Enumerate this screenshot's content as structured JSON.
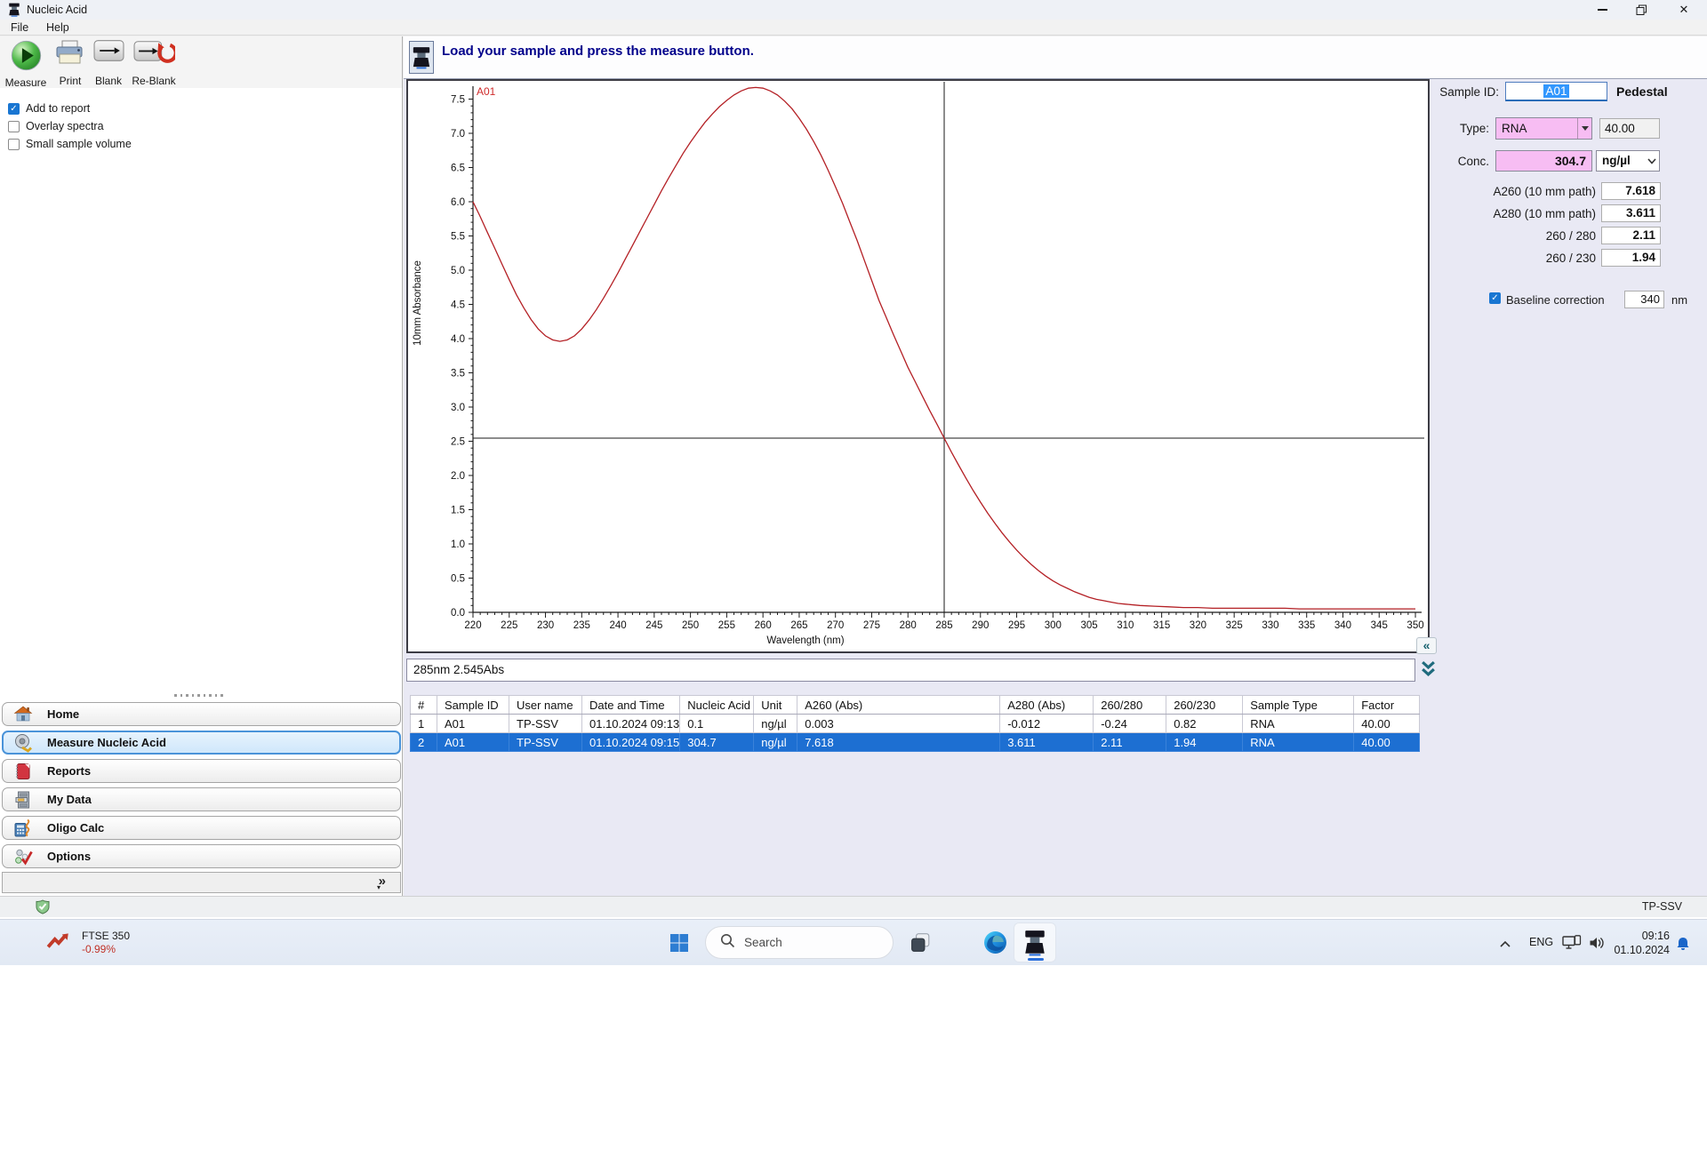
{
  "window": {
    "title": "Nucleic Acid"
  },
  "menu": {
    "items": [
      {
        "label": "File"
      },
      {
        "label": "Help"
      }
    ]
  },
  "toolbar": {
    "buttons": [
      {
        "id": "measure",
        "label": "Measure"
      },
      {
        "id": "print",
        "label": "Print"
      },
      {
        "id": "blank",
        "label": "Blank"
      },
      {
        "id": "reblank",
        "label": "Re-Blank"
      }
    ]
  },
  "options": {
    "items": [
      {
        "label": "Add to report",
        "checked": true
      },
      {
        "label": "Overlay spectra",
        "checked": false
      },
      {
        "label": "Small sample volume",
        "checked": false
      }
    ]
  },
  "message_bar": {
    "text": "Load your sample and press the measure button."
  },
  "chart_data": {
    "type": "line",
    "title": "",
    "xlabel": "Wavelength (nm)",
    "ylabel": "10mm Absorbance",
    "xlim": [
      220,
      350
    ],
    "ylim": [
      0,
      7.8
    ],
    "grid": false,
    "legend": "none",
    "x_ticks": [
      220,
      225,
      230,
      235,
      240,
      245,
      250,
      255,
      260,
      265,
      270,
      275,
      280,
      285,
      290,
      295,
      300,
      305,
      310,
      315,
      320,
      325,
      330,
      335,
      340,
      345,
      350
    ],
    "y_ticks": [
      0,
      0.5,
      1,
      1.5,
      2,
      2.5,
      3,
      3.5,
      4,
      4.5,
      5,
      5.5,
      6,
      6.5,
      7,
      7.5
    ],
    "x_minor_step": 1,
    "y_minor_step": 0.1,
    "series_label": {
      "text": "A01",
      "color": "#cf2a2a"
    },
    "crosshair": {
      "x": 285,
      "y": 2.545,
      "color": "#1a1a1a"
    },
    "series": [
      {
        "name": "A01",
        "color": "#b42025",
        "x": [
          220,
          221,
          222,
          223,
          224,
          225,
          226,
          227,
          228,
          229,
          230,
          231,
          232,
          233,
          234,
          235,
          236,
          237,
          238,
          239,
          240,
          241,
          242,
          243,
          244,
          245,
          246,
          247,
          248,
          249,
          250,
          251,
          252,
          253,
          254,
          255,
          256,
          257,
          258,
          259,
          260,
          261,
          262,
          263,
          264,
          265,
          266,
          267,
          268,
          269,
          270,
          271,
          272,
          273,
          274,
          275,
          276,
          277,
          278,
          279,
          280,
          281,
          282,
          283,
          284,
          285,
          286,
          287,
          288,
          289,
          290,
          291,
          292,
          293,
          294,
          295,
          296,
          297,
          298,
          299,
          300,
          301,
          302,
          303,
          304,
          305,
          306,
          307,
          308,
          309,
          310,
          312,
          314,
          316,
          318,
          320,
          322,
          324,
          326,
          328,
          330,
          332,
          334,
          336,
          338,
          340,
          342,
          344,
          346,
          348,
          350
        ],
        "y": [
          6.0,
          5.78,
          5.55,
          5.32,
          5.09,
          4.86,
          4.64,
          4.45,
          4.28,
          4.14,
          4.04,
          3.98,
          3.96,
          3.98,
          4.04,
          4.14,
          4.27,
          4.42,
          4.59,
          4.77,
          4.96,
          5.16,
          5.36,
          5.56,
          5.76,
          5.96,
          6.16,
          6.35,
          6.53,
          6.71,
          6.87,
          7.02,
          7.16,
          7.28,
          7.39,
          7.48,
          7.56,
          7.62,
          7.66,
          7.67,
          7.66,
          7.62,
          7.56,
          7.47,
          7.36,
          7.22,
          7.06,
          6.88,
          6.68,
          6.46,
          6.22,
          5.97,
          5.7,
          5.43,
          5.14,
          4.85,
          4.56,
          4.31,
          4.06,
          3.82,
          3.58,
          3.37,
          3.16,
          2.95,
          2.75,
          2.545,
          2.34,
          2.15,
          1.96,
          1.78,
          1.61,
          1.45,
          1.3,
          1.16,
          1.03,
          0.91,
          0.8,
          0.7,
          0.61,
          0.53,
          0.46,
          0.4,
          0.35,
          0.3,
          0.26,
          0.22,
          0.19,
          0.17,
          0.15,
          0.13,
          0.12,
          0.1,
          0.09,
          0.08,
          0.07,
          0.07,
          0.06,
          0.06,
          0.06,
          0.06,
          0.06,
          0.06,
          0.05,
          0.05,
          0.05,
          0.05,
          0.05,
          0.05,
          0.05,
          0.05,
          0.05
        ]
      }
    ]
  },
  "chart_tools": {
    "collapse_glyph": "«"
  },
  "status_readout": {
    "text": "285nm 2.545Abs"
  },
  "sample_panel": {
    "sample_id_label": "Sample ID:",
    "sample_id_value": "A01",
    "mode_label": "Pedestal",
    "type_label": "Type:",
    "type_value": "RNA",
    "factor_value": "40.00",
    "conc_label": "Conc.",
    "conc_value": "304.7",
    "conc_unit": "ng/µl",
    "rows": [
      {
        "label": "A260 (10 mm path)",
        "value": "7.618"
      },
      {
        "label": "A280 (10 mm path)",
        "value": "3.611"
      },
      {
        "label": "260 / 280",
        "value": "2.11"
      },
      {
        "label": "260 / 230",
        "value": "1.94"
      }
    ],
    "baseline": {
      "label": "Baseline correction",
      "checked": true,
      "value": "340",
      "unit": "nm"
    }
  },
  "results_table": {
    "columns": [
      "#",
      "Sample ID",
      "User name",
      "Date and Time",
      "Nucleic Acid",
      "Unit",
      "A260 (Abs)",
      "A280 (Abs)",
      "260/280",
      "260/230",
      "Sample Type",
      "Factor"
    ],
    "rows": [
      [
        "1",
        "A01",
        "TP-SSV",
        "01.10.2024 09:13",
        "0.1",
        "ng/µl",
        "0.003",
        "-0.012",
        "-0.24",
        "0.82",
        "RNA",
        "40.00"
      ],
      [
        "2",
        "A01",
        "TP-SSV",
        "01.10.2024 09:15",
        "304.7",
        "ng/µl",
        "7.618",
        "3.611",
        "2.11",
        "1.94",
        "RNA",
        "40.00"
      ]
    ],
    "selected_row_index": 1
  },
  "sidebar": {
    "items": [
      {
        "label": "Home",
        "icon": "home-icon",
        "selected": false
      },
      {
        "label": "Measure Nucleic Acid",
        "icon": "measure-nucleic-acid-icon",
        "selected": true
      },
      {
        "label": "Reports",
        "icon": "reports-icon",
        "selected": false
      },
      {
        "label": "My Data",
        "icon": "my-data-icon",
        "selected": false
      },
      {
        "label": "Oligo Calc",
        "icon": "oligo-calc-icon",
        "selected": false
      },
      {
        "label": "Options",
        "icon": "options-icon",
        "selected": false
      }
    ]
  },
  "app_status": {
    "user": "TP-SSV"
  },
  "taskbar": {
    "widget": {
      "title": "FTSE 350",
      "change": "-0.99%",
      "change_color": "#c03126"
    },
    "search_placeholder": "Search",
    "tray": {
      "language": "ENG",
      "time": "09:16",
      "date": "01.10.2024"
    }
  },
  "colors": {
    "accent": "#1d6fd2",
    "panel": "#e9e9f4",
    "selection": "#3297fd",
    "field_pink": "#f7bdf3",
    "curve": "#b42025"
  }
}
